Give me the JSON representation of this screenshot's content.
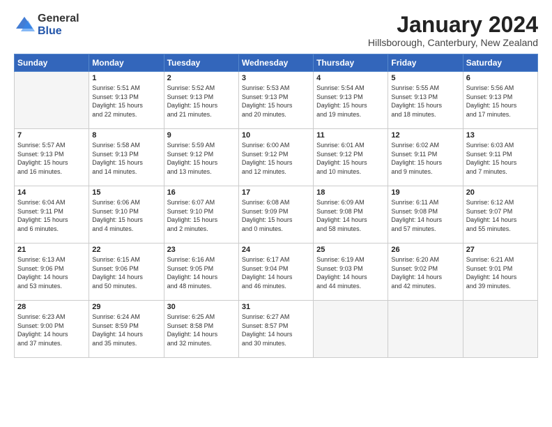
{
  "logo": {
    "general": "General",
    "blue": "Blue"
  },
  "title": "January 2024",
  "location": "Hillsborough, Canterbury, New Zealand",
  "weekdays": [
    "Sunday",
    "Monday",
    "Tuesday",
    "Wednesday",
    "Thursday",
    "Friday",
    "Saturday"
  ],
  "weeks": [
    [
      {
        "day": "",
        "empty": true
      },
      {
        "day": "1",
        "line1": "Sunrise: 5:51 AM",
        "line2": "Sunset: 9:13 PM",
        "line3": "Daylight: 15 hours",
        "line4": "and 22 minutes."
      },
      {
        "day": "2",
        "line1": "Sunrise: 5:52 AM",
        "line2": "Sunset: 9:13 PM",
        "line3": "Daylight: 15 hours",
        "line4": "and 21 minutes."
      },
      {
        "day": "3",
        "line1": "Sunrise: 5:53 AM",
        "line2": "Sunset: 9:13 PM",
        "line3": "Daylight: 15 hours",
        "line4": "and 20 minutes."
      },
      {
        "day": "4",
        "line1": "Sunrise: 5:54 AM",
        "line2": "Sunset: 9:13 PM",
        "line3": "Daylight: 15 hours",
        "line4": "and 19 minutes."
      },
      {
        "day": "5",
        "line1": "Sunrise: 5:55 AM",
        "line2": "Sunset: 9:13 PM",
        "line3": "Daylight: 15 hours",
        "line4": "and 18 minutes."
      },
      {
        "day": "6",
        "line1": "Sunrise: 5:56 AM",
        "line2": "Sunset: 9:13 PM",
        "line3": "Daylight: 15 hours",
        "line4": "and 17 minutes."
      }
    ],
    [
      {
        "day": "7",
        "line1": "Sunrise: 5:57 AM",
        "line2": "Sunset: 9:13 PM",
        "line3": "Daylight: 15 hours",
        "line4": "and 16 minutes."
      },
      {
        "day": "8",
        "line1": "Sunrise: 5:58 AM",
        "line2": "Sunset: 9:13 PM",
        "line3": "Daylight: 15 hours",
        "line4": "and 14 minutes."
      },
      {
        "day": "9",
        "line1": "Sunrise: 5:59 AM",
        "line2": "Sunset: 9:12 PM",
        "line3": "Daylight: 15 hours",
        "line4": "and 13 minutes."
      },
      {
        "day": "10",
        "line1": "Sunrise: 6:00 AM",
        "line2": "Sunset: 9:12 PM",
        "line3": "Daylight: 15 hours",
        "line4": "and 12 minutes."
      },
      {
        "day": "11",
        "line1": "Sunrise: 6:01 AM",
        "line2": "Sunset: 9:12 PM",
        "line3": "Daylight: 15 hours",
        "line4": "and 10 minutes."
      },
      {
        "day": "12",
        "line1": "Sunrise: 6:02 AM",
        "line2": "Sunset: 9:11 PM",
        "line3": "Daylight: 15 hours",
        "line4": "and 9 minutes."
      },
      {
        "day": "13",
        "line1": "Sunrise: 6:03 AM",
        "line2": "Sunset: 9:11 PM",
        "line3": "Daylight: 15 hours",
        "line4": "and 7 minutes."
      }
    ],
    [
      {
        "day": "14",
        "line1": "Sunrise: 6:04 AM",
        "line2": "Sunset: 9:11 PM",
        "line3": "Daylight: 15 hours",
        "line4": "and 6 minutes."
      },
      {
        "day": "15",
        "line1": "Sunrise: 6:06 AM",
        "line2": "Sunset: 9:10 PM",
        "line3": "Daylight: 15 hours",
        "line4": "and 4 minutes."
      },
      {
        "day": "16",
        "line1": "Sunrise: 6:07 AM",
        "line2": "Sunset: 9:10 PM",
        "line3": "Daylight: 15 hours",
        "line4": "and 2 minutes."
      },
      {
        "day": "17",
        "line1": "Sunrise: 6:08 AM",
        "line2": "Sunset: 9:09 PM",
        "line3": "Daylight: 15 hours",
        "line4": "and 0 minutes."
      },
      {
        "day": "18",
        "line1": "Sunrise: 6:09 AM",
        "line2": "Sunset: 9:08 PM",
        "line3": "Daylight: 14 hours",
        "line4": "and 58 minutes."
      },
      {
        "day": "19",
        "line1": "Sunrise: 6:11 AM",
        "line2": "Sunset: 9:08 PM",
        "line3": "Daylight: 14 hours",
        "line4": "and 57 minutes."
      },
      {
        "day": "20",
        "line1": "Sunrise: 6:12 AM",
        "line2": "Sunset: 9:07 PM",
        "line3": "Daylight: 14 hours",
        "line4": "and 55 minutes."
      }
    ],
    [
      {
        "day": "21",
        "line1": "Sunrise: 6:13 AM",
        "line2": "Sunset: 9:06 PM",
        "line3": "Daylight: 14 hours",
        "line4": "and 53 minutes."
      },
      {
        "day": "22",
        "line1": "Sunrise: 6:15 AM",
        "line2": "Sunset: 9:06 PM",
        "line3": "Daylight: 14 hours",
        "line4": "and 50 minutes."
      },
      {
        "day": "23",
        "line1": "Sunrise: 6:16 AM",
        "line2": "Sunset: 9:05 PM",
        "line3": "Daylight: 14 hours",
        "line4": "and 48 minutes."
      },
      {
        "day": "24",
        "line1": "Sunrise: 6:17 AM",
        "line2": "Sunset: 9:04 PM",
        "line3": "Daylight: 14 hours",
        "line4": "and 46 minutes."
      },
      {
        "day": "25",
        "line1": "Sunrise: 6:19 AM",
        "line2": "Sunset: 9:03 PM",
        "line3": "Daylight: 14 hours",
        "line4": "and 44 minutes."
      },
      {
        "day": "26",
        "line1": "Sunrise: 6:20 AM",
        "line2": "Sunset: 9:02 PM",
        "line3": "Daylight: 14 hours",
        "line4": "and 42 minutes."
      },
      {
        "day": "27",
        "line1": "Sunrise: 6:21 AM",
        "line2": "Sunset: 9:01 PM",
        "line3": "Daylight: 14 hours",
        "line4": "and 39 minutes."
      }
    ],
    [
      {
        "day": "28",
        "line1": "Sunrise: 6:23 AM",
        "line2": "Sunset: 9:00 PM",
        "line3": "Daylight: 14 hours",
        "line4": "and 37 minutes."
      },
      {
        "day": "29",
        "line1": "Sunrise: 6:24 AM",
        "line2": "Sunset: 8:59 PM",
        "line3": "Daylight: 14 hours",
        "line4": "and 35 minutes."
      },
      {
        "day": "30",
        "line1": "Sunrise: 6:25 AM",
        "line2": "Sunset: 8:58 PM",
        "line3": "Daylight: 14 hours",
        "line4": "and 32 minutes."
      },
      {
        "day": "31",
        "line1": "Sunrise: 6:27 AM",
        "line2": "Sunset: 8:57 PM",
        "line3": "Daylight: 14 hours",
        "line4": "and 30 minutes."
      },
      {
        "day": "",
        "empty": true
      },
      {
        "day": "",
        "empty": true
      },
      {
        "day": "",
        "empty": true
      }
    ]
  ]
}
